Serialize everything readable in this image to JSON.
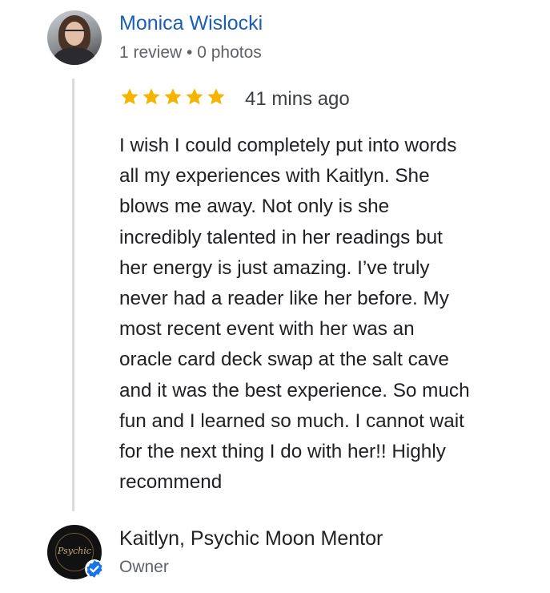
{
  "review": {
    "reviewer_name": "Monica Wislocki",
    "reviewer_meta": "1 review • 0 photos",
    "rating": 5,
    "rating_max": 5,
    "time_ago": "41 mins ago",
    "text_lines": [
      "I wish I could completely put into words",
      "all my experiences with Kaitlyn. She",
      "blows me away. Not only is she",
      "incredibly talented in her readings but",
      "her energy is just amazing. I’ve truly",
      "never had a reader like her before. My",
      "most recent event with her was an",
      "oracle card deck swap at the salt cave",
      "and it was the best experience. So much",
      "fun and I learned so much. I cannot wait",
      "for the next thing I do with her!! Highly",
      "recommend"
    ]
  },
  "owner_reply": {
    "name": "Kaitlyn, Psychic Moon Mentor",
    "role": "Owner",
    "logo_text": "Psychic"
  },
  "icons": {
    "star": "star-icon",
    "verified": "verified-badge-icon"
  },
  "colors": {
    "star": "#f4b400",
    "name_link": "#1a5fb4",
    "verified": "#1a73e8"
  }
}
